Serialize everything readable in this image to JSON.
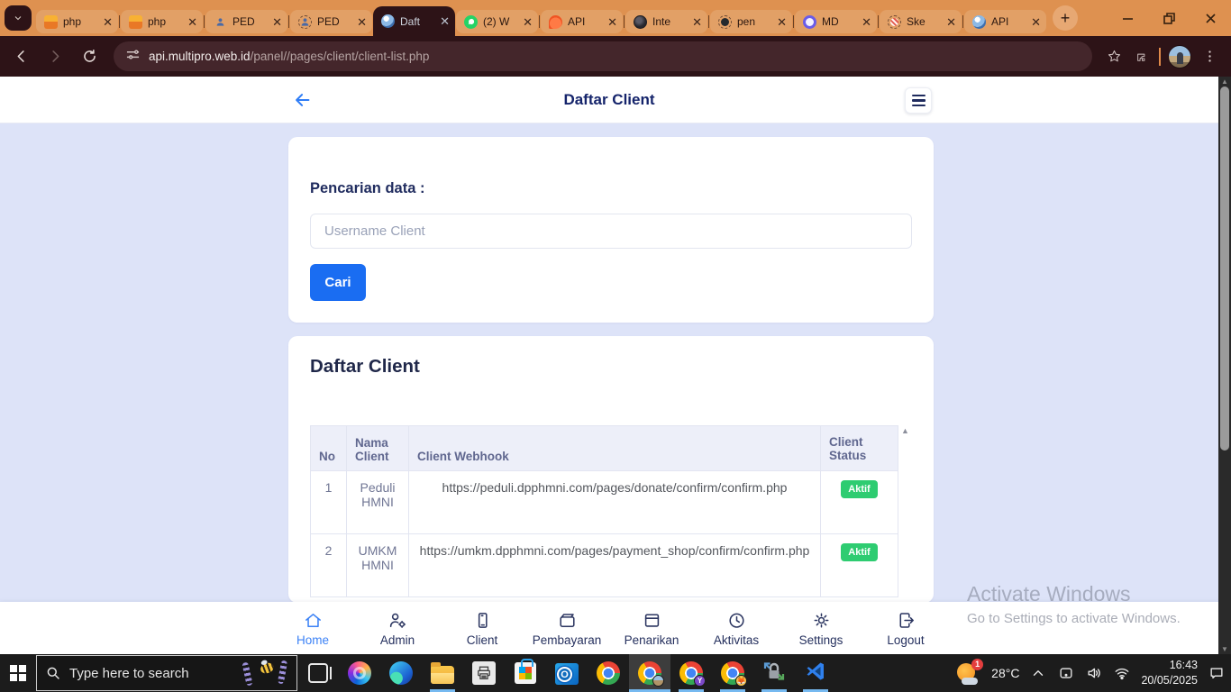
{
  "browser": {
    "tabs": [
      {
        "title": "php",
        "favicon": "phpmyadmin",
        "active": false
      },
      {
        "title": "php",
        "favicon": "phpmyadmin",
        "active": false
      },
      {
        "title": "PED",
        "favicon": "person",
        "active": false
      },
      {
        "title": "PED",
        "favicon": "person-loading",
        "active": false
      },
      {
        "title": "Daft",
        "favicon": "globe-blue",
        "active": true
      },
      {
        "title": "(2) W",
        "favicon": "whatsapp",
        "active": false
      },
      {
        "title": "API",
        "favicon": "flame-orange",
        "active": false
      },
      {
        "title": "Inte",
        "favicon": "globe-dark",
        "active": false
      },
      {
        "title": "pen",
        "favicon": "github",
        "active": false
      },
      {
        "title": "MD",
        "favicon": "ring-purple",
        "active": false
      },
      {
        "title": "Ske",
        "favicon": "dashed-red",
        "active": false
      },
      {
        "title": "API",
        "favicon": "globe-blue",
        "active": false
      }
    ],
    "new_tab_label": "+",
    "address": {
      "domain": "api.multipro.web.id",
      "path": "/panel//pages/client/client-list.php"
    }
  },
  "page": {
    "header": {
      "title": "Daftar Client"
    },
    "search_card": {
      "label": "Pencarian data :",
      "placeholder": "Username Client",
      "button_label": "Cari"
    },
    "table_card": {
      "title": "Daftar Client",
      "columns": [
        "No",
        "Nama Client",
        "Client Webhook",
        "Client Status"
      ],
      "rows": [
        {
          "no": "1",
          "name": "Peduli HMNI",
          "webhook": "https://peduli.dpphmni.com/pages/donate/confirm/confirm.php",
          "status": "Aktif"
        },
        {
          "no": "2",
          "name": "UMKM HMNI",
          "webhook": "https://umkm.dpphmni.com/pages/payment_shop/confirm/confirm.php",
          "status": "Aktif"
        }
      ]
    },
    "bottom_nav": [
      {
        "label": "Home",
        "icon": "home",
        "active": true
      },
      {
        "label": "Admin",
        "icon": "admin-user",
        "active": false
      },
      {
        "label": "Client",
        "icon": "mobile-card",
        "active": false
      },
      {
        "label": "Pembayaran",
        "icon": "wallet",
        "active": false
      },
      {
        "label": "Penarikan",
        "icon": "archive-box",
        "active": false
      },
      {
        "label": "Aktivitas",
        "icon": "clock",
        "active": false
      },
      {
        "label": "Settings",
        "icon": "gear",
        "active": false
      },
      {
        "label": "Logout",
        "icon": "logout",
        "active": false
      }
    ],
    "watermark": {
      "line1": "Activate Windows",
      "line2": "Go to Settings to activate Windows."
    }
  },
  "taskbar": {
    "search_placeholder": "Type here to search",
    "app_icons": [
      {
        "name": "task-view",
        "running": false,
        "active": false
      },
      {
        "name": "copilot",
        "running": false,
        "active": false
      },
      {
        "name": "edge",
        "running": false,
        "active": false
      },
      {
        "name": "file-explorer",
        "running": true,
        "active": false
      },
      {
        "name": "printer",
        "running": false,
        "active": false
      },
      {
        "name": "microsoft-store",
        "running": false,
        "active": false
      },
      {
        "name": "outlook",
        "running": false,
        "active": false
      },
      {
        "name": "chrome",
        "running": false,
        "active": false
      },
      {
        "name": "chrome-profile-main",
        "running": true,
        "active": true
      },
      {
        "name": "chrome-profile-2",
        "running": true,
        "active": false
      },
      {
        "name": "chrome-profile-3",
        "running": true,
        "active": false
      },
      {
        "name": "secure-sync",
        "running": true,
        "active": false
      },
      {
        "name": "vscode",
        "running": true,
        "active": false
      }
    ],
    "tray": {
      "notification_count": "1",
      "temperature": "28°C",
      "time": "16:43",
      "date": "20/05/2025"
    }
  },
  "colors": {
    "tabstrip": "#de9150",
    "toolbar": "#2d1317",
    "accent_blue": "#1a6df2",
    "page_background": "#dde3f8",
    "navy_text": "#1f2b5e",
    "status_green": "#2ecc71"
  }
}
